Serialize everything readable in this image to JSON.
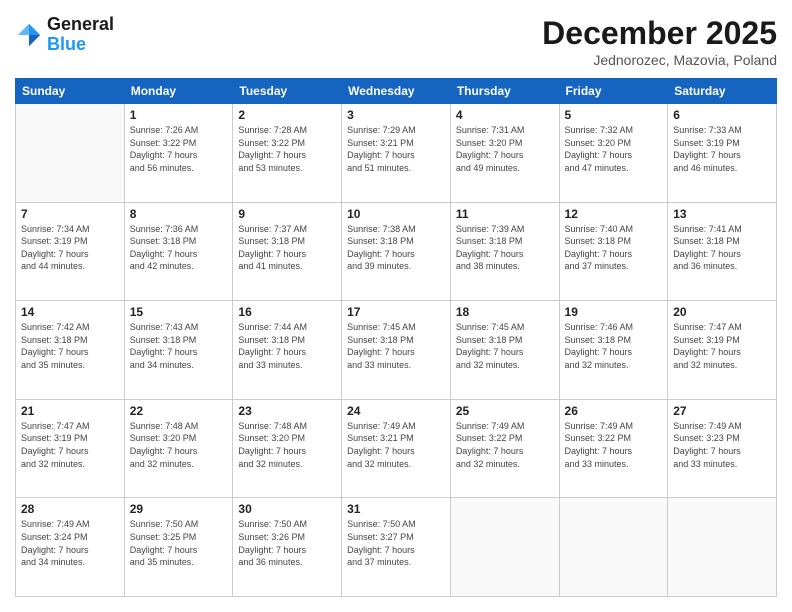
{
  "header": {
    "logo_line1": "General",
    "logo_line2": "Blue",
    "month": "December 2025",
    "location": "Jednorozec, Mazovia, Poland"
  },
  "days_of_week": [
    "Sunday",
    "Monday",
    "Tuesday",
    "Wednesday",
    "Thursday",
    "Friday",
    "Saturday"
  ],
  "weeks": [
    [
      {
        "day": "",
        "info": ""
      },
      {
        "day": "1",
        "info": "Sunrise: 7:26 AM\nSunset: 3:22 PM\nDaylight: 7 hours\nand 56 minutes."
      },
      {
        "day": "2",
        "info": "Sunrise: 7:28 AM\nSunset: 3:22 PM\nDaylight: 7 hours\nand 53 minutes."
      },
      {
        "day": "3",
        "info": "Sunrise: 7:29 AM\nSunset: 3:21 PM\nDaylight: 7 hours\nand 51 minutes."
      },
      {
        "day": "4",
        "info": "Sunrise: 7:31 AM\nSunset: 3:20 PM\nDaylight: 7 hours\nand 49 minutes."
      },
      {
        "day": "5",
        "info": "Sunrise: 7:32 AM\nSunset: 3:20 PM\nDaylight: 7 hours\nand 47 minutes."
      },
      {
        "day": "6",
        "info": "Sunrise: 7:33 AM\nSunset: 3:19 PM\nDaylight: 7 hours\nand 46 minutes."
      }
    ],
    [
      {
        "day": "7",
        "info": "Sunrise: 7:34 AM\nSunset: 3:19 PM\nDaylight: 7 hours\nand 44 minutes."
      },
      {
        "day": "8",
        "info": "Sunrise: 7:36 AM\nSunset: 3:18 PM\nDaylight: 7 hours\nand 42 minutes."
      },
      {
        "day": "9",
        "info": "Sunrise: 7:37 AM\nSunset: 3:18 PM\nDaylight: 7 hours\nand 41 minutes."
      },
      {
        "day": "10",
        "info": "Sunrise: 7:38 AM\nSunset: 3:18 PM\nDaylight: 7 hours\nand 39 minutes."
      },
      {
        "day": "11",
        "info": "Sunrise: 7:39 AM\nSunset: 3:18 PM\nDaylight: 7 hours\nand 38 minutes."
      },
      {
        "day": "12",
        "info": "Sunrise: 7:40 AM\nSunset: 3:18 PM\nDaylight: 7 hours\nand 37 minutes."
      },
      {
        "day": "13",
        "info": "Sunrise: 7:41 AM\nSunset: 3:18 PM\nDaylight: 7 hours\nand 36 minutes."
      }
    ],
    [
      {
        "day": "14",
        "info": "Sunrise: 7:42 AM\nSunset: 3:18 PM\nDaylight: 7 hours\nand 35 minutes."
      },
      {
        "day": "15",
        "info": "Sunrise: 7:43 AM\nSunset: 3:18 PM\nDaylight: 7 hours\nand 34 minutes."
      },
      {
        "day": "16",
        "info": "Sunrise: 7:44 AM\nSunset: 3:18 PM\nDaylight: 7 hours\nand 33 minutes."
      },
      {
        "day": "17",
        "info": "Sunrise: 7:45 AM\nSunset: 3:18 PM\nDaylight: 7 hours\nand 33 minutes."
      },
      {
        "day": "18",
        "info": "Sunrise: 7:45 AM\nSunset: 3:18 PM\nDaylight: 7 hours\nand 32 minutes."
      },
      {
        "day": "19",
        "info": "Sunrise: 7:46 AM\nSunset: 3:18 PM\nDaylight: 7 hours\nand 32 minutes."
      },
      {
        "day": "20",
        "info": "Sunrise: 7:47 AM\nSunset: 3:19 PM\nDaylight: 7 hours\nand 32 minutes."
      }
    ],
    [
      {
        "day": "21",
        "info": "Sunrise: 7:47 AM\nSunset: 3:19 PM\nDaylight: 7 hours\nand 32 minutes."
      },
      {
        "day": "22",
        "info": "Sunrise: 7:48 AM\nSunset: 3:20 PM\nDaylight: 7 hours\nand 32 minutes."
      },
      {
        "day": "23",
        "info": "Sunrise: 7:48 AM\nSunset: 3:20 PM\nDaylight: 7 hours\nand 32 minutes."
      },
      {
        "day": "24",
        "info": "Sunrise: 7:49 AM\nSunset: 3:21 PM\nDaylight: 7 hours\nand 32 minutes."
      },
      {
        "day": "25",
        "info": "Sunrise: 7:49 AM\nSunset: 3:22 PM\nDaylight: 7 hours\nand 32 minutes."
      },
      {
        "day": "26",
        "info": "Sunrise: 7:49 AM\nSunset: 3:22 PM\nDaylight: 7 hours\nand 33 minutes."
      },
      {
        "day": "27",
        "info": "Sunrise: 7:49 AM\nSunset: 3:23 PM\nDaylight: 7 hours\nand 33 minutes."
      }
    ],
    [
      {
        "day": "28",
        "info": "Sunrise: 7:49 AM\nSunset: 3:24 PM\nDaylight: 7 hours\nand 34 minutes."
      },
      {
        "day": "29",
        "info": "Sunrise: 7:50 AM\nSunset: 3:25 PM\nDaylight: 7 hours\nand 35 minutes."
      },
      {
        "day": "30",
        "info": "Sunrise: 7:50 AM\nSunset: 3:26 PM\nDaylight: 7 hours\nand 36 minutes."
      },
      {
        "day": "31",
        "info": "Sunrise: 7:50 AM\nSunset: 3:27 PM\nDaylight: 7 hours\nand 37 minutes."
      },
      {
        "day": "",
        "info": ""
      },
      {
        "day": "",
        "info": ""
      },
      {
        "day": "",
        "info": ""
      }
    ]
  ]
}
